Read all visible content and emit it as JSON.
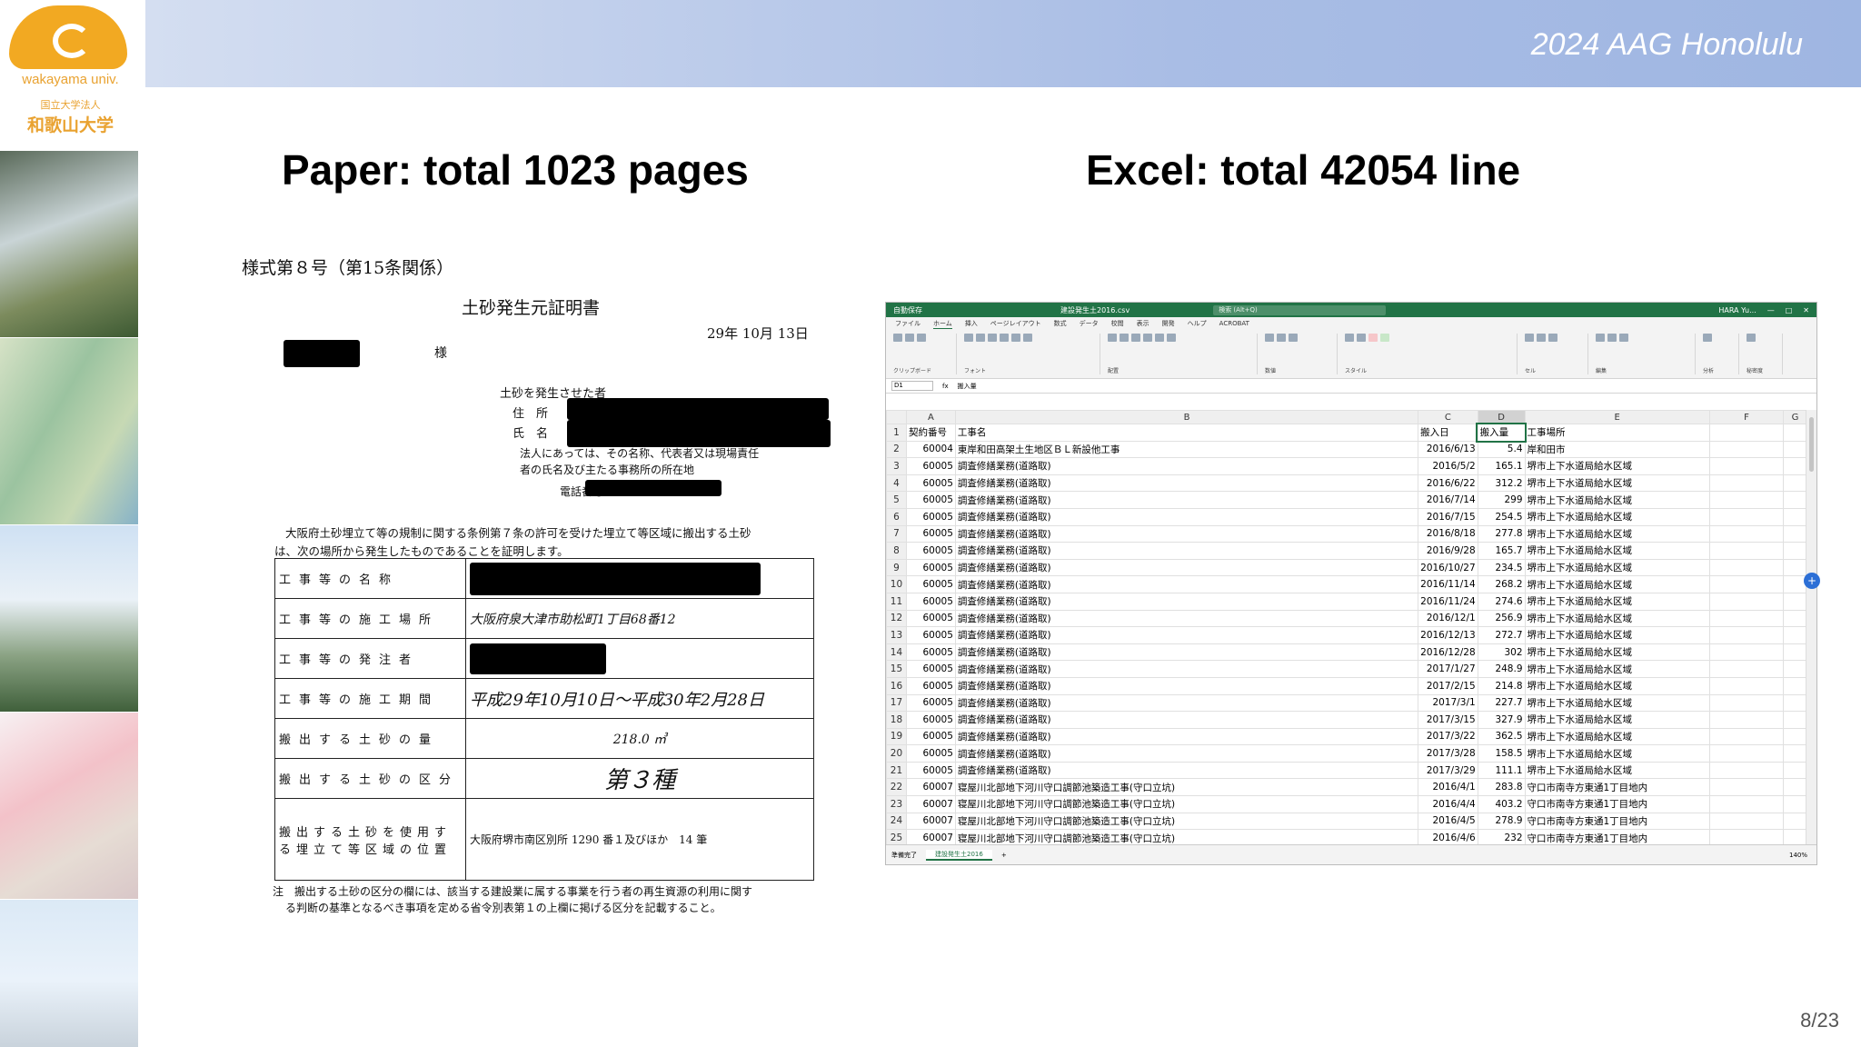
{
  "header": {
    "conference": "2024 AAG Honolulu"
  },
  "logo": {
    "text_en": "wakayama univ.",
    "text_jp_small": "国立大学法人",
    "text_jp": "和歌山大学"
  },
  "slide": {
    "left_title": "Paper: total 1023 pages",
    "right_title": "Excel: total 42054 line",
    "page_number": "8/23"
  },
  "paper": {
    "form_no": "様式第８号（第15条関係）",
    "doc_title": "土砂発生元証明書",
    "date": "29年 10月 13日",
    "recipient_suffix": "様",
    "issuer_heading": "土砂を発生させた者",
    "address_label": "住　所",
    "name_label": "氏　名",
    "corp_note_1": "法人にあっては、その名称、代表者又は現場責任",
    "corp_note_2": "者の氏名及び主たる事務所の所在地",
    "phone_label": "電話番号",
    "body_1": "大阪府土砂埋立て等の規制に関する条例第７条の許可を受けた埋立て等区域に搬出する土砂",
    "body_2": "は、次の場所から発生したものであることを証明します。",
    "rows": [
      {
        "label": "工事等の名称",
        "value": ""
      },
      {
        "label": "工事等の施工場所",
        "value": "大阪府泉大津市助松町1丁目68番12"
      },
      {
        "label": "工事等の発注者",
        "value": ""
      },
      {
        "label": "工事等の施工期間",
        "value": "平成29年10月10日～平成30年2月28日"
      },
      {
        "label": "搬出する土砂の量",
        "value": "218.0 ㎥"
      },
      {
        "label": "搬出する土砂の区分",
        "value": "第３種"
      },
      {
        "label": "搬出する土砂を使用する埋立て等区域の位置",
        "value": "大阪府堺市南区別所 1290 番１及びほか　14 筆"
      }
    ],
    "note_1": "注　搬出する土砂の区分の欄には、該当する建設業に属する事業を行う者の再生資源の利用に関す",
    "note_2": "る判断の基準となるべき事項を定める省令別表第１の上欄に掲げる区分を記載すること。"
  },
  "excel": {
    "titlebar": {
      "autosave": "自動保存",
      "filename": "建設発生土2016.csv",
      "search": "検索 (Alt+Q)",
      "user": "HARA Yu..."
    },
    "menu": [
      "ファイル",
      "ホーム",
      "挿入",
      "ページレイアウト",
      "数式",
      "データ",
      "校閲",
      "表示",
      "開発",
      "ヘルプ",
      "ACROBAT"
    ],
    "ribbon_groups": [
      "クリップボード",
      "フォント",
      "配置",
      "数値",
      "スタイル",
      "セル",
      "編集",
      "分析",
      "秘密度"
    ],
    "name_box": "D1",
    "formula": "搬入量",
    "columns": [
      "A",
      "B",
      "C",
      "D",
      "E",
      "F",
      "G"
    ],
    "rows": [
      [
        "1",
        "契約番号",
        "工事名",
        "搬入日",
        "搬入量",
        "工事場所"
      ],
      [
        "2",
        "60004",
        "東岸和田高架土生地区ＢＬ新設他工事",
        "2016/6/13",
        "5.4",
        "岸和田市"
      ],
      [
        "3",
        "60005",
        "調査修繕業務(道路取)",
        "2016/5/2",
        "165.1",
        "堺市上下水道局給水区域"
      ],
      [
        "4",
        "60005",
        "調査修繕業務(道路取)",
        "2016/6/22",
        "312.2",
        "堺市上下水道局給水区域"
      ],
      [
        "5",
        "60005",
        "調査修繕業務(道路取)",
        "2016/7/14",
        "299",
        "堺市上下水道局給水区域"
      ],
      [
        "6",
        "60005",
        "調査修繕業務(道路取)",
        "2016/7/15",
        "254.5",
        "堺市上下水道局給水区域"
      ],
      [
        "7",
        "60005",
        "調査修繕業務(道路取)",
        "2016/8/18",
        "277.8",
        "堺市上下水道局給水区域"
      ],
      [
        "8",
        "60005",
        "調査修繕業務(道路取)",
        "2016/9/28",
        "165.7",
        "堺市上下水道局給水区域"
      ],
      [
        "9",
        "60005",
        "調査修繕業務(道路取)",
        "2016/10/27",
        "234.5",
        "堺市上下水道局給水区域"
      ],
      [
        "10",
        "60005",
        "調査修繕業務(道路取)",
        "2016/11/14",
        "268.2",
        "堺市上下水道局給水区域"
      ],
      [
        "11",
        "60005",
        "調査修繕業務(道路取)",
        "2016/11/24",
        "274.6",
        "堺市上下水道局給水区域"
      ],
      [
        "12",
        "60005",
        "調査修繕業務(道路取)",
        "2016/12/1",
        "256.9",
        "堺市上下水道局給水区域"
      ],
      [
        "13",
        "60005",
        "調査修繕業務(道路取)",
        "2016/12/13",
        "272.7",
        "堺市上下水道局給水区域"
      ],
      [
        "14",
        "60005",
        "調査修繕業務(道路取)",
        "2016/12/28",
        "302",
        "堺市上下水道局給水区域"
      ],
      [
        "15",
        "60005",
        "調査修繕業務(道路取)",
        "2017/1/27",
        "248.9",
        "堺市上下水道局給水区域"
      ],
      [
        "16",
        "60005",
        "調査修繕業務(道路取)",
        "2017/2/15",
        "214.8",
        "堺市上下水道局給水区域"
      ],
      [
        "17",
        "60005",
        "調査修繕業務(道路取)",
        "2017/3/1",
        "227.7",
        "堺市上下水道局給水区域"
      ],
      [
        "18",
        "60005",
        "調査修繕業務(道路取)",
        "2017/3/15",
        "327.9",
        "堺市上下水道局給水区域"
      ],
      [
        "19",
        "60005",
        "調査修繕業務(道路取)",
        "2017/3/22",
        "362.5",
        "堺市上下水道局給水区域"
      ],
      [
        "20",
        "60005",
        "調査修繕業務(道路取)",
        "2017/3/28",
        "158.5",
        "堺市上下水道局給水区域"
      ],
      [
        "21",
        "60005",
        "調査修繕業務(道路取)",
        "2017/3/29",
        "111.1",
        "堺市上下水道局給水区域"
      ],
      [
        "22",
        "60007",
        "寝屋川北部地下河川守口調節池築造工事(守口立坑)",
        "2016/4/1",
        "283.8",
        "守口市南寺方東通1丁目地内"
      ],
      [
        "23",
        "60007",
        "寝屋川北部地下河川守口調節池築造工事(守口立坑)",
        "2016/4/4",
        "403.2",
        "守口市南寺方東通1丁目地内"
      ],
      [
        "24",
        "60007",
        "寝屋川北部地下河川守口調節池築造工事(守口立坑)",
        "2016/4/5",
        "278.9",
        "守口市南寺方東通1丁目地内"
      ],
      [
        "25",
        "60007",
        "寝屋川北部地下河川守口調節池築造工事(守口立坑)",
        "2016/4/6",
        "232",
        "守口市南寺方東通1丁目地内"
      ]
    ],
    "sheet_tab": "建設発生土2016",
    "status": "準備完了",
    "zoom": "140%",
    "accent": "#217346"
  }
}
